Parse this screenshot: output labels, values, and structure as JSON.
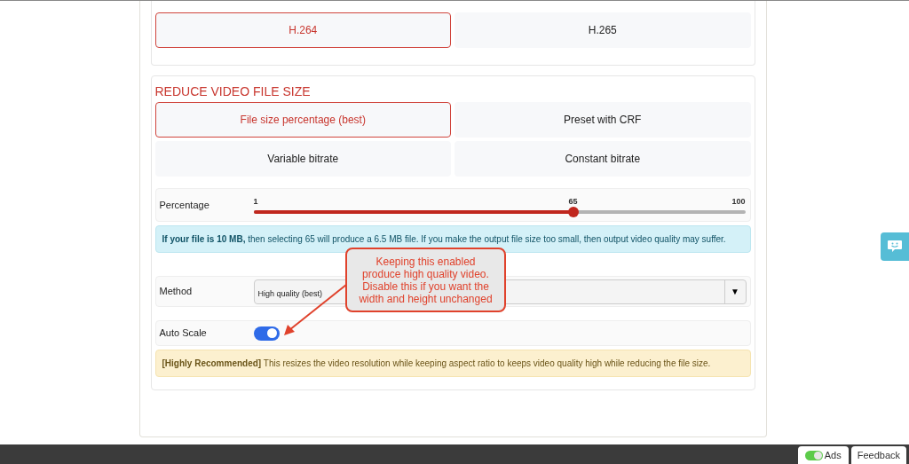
{
  "codec_options": [
    {
      "label": "H.264",
      "selected": true
    },
    {
      "label": "H.265",
      "selected": false
    }
  ],
  "reduce": {
    "heading": "REDUCE VIDEO FILE SIZE",
    "options": [
      {
        "label": "File size percentage (best)",
        "selected": true
      },
      {
        "label": "Preset with CRF",
        "selected": false
      },
      {
        "label": "Variable bitrate",
        "selected": false
      },
      {
        "label": "Constant bitrate",
        "selected": false
      }
    ],
    "percentage": {
      "label": "Percentage",
      "min": "1",
      "value": "65",
      "max": "100",
      "level": 0.65
    },
    "info": "**If your file is 10 MB,** then selecting 65 will produce a 6.5 MB file. If you make the output file size too small, then output video quality may suffer.",
    "method": {
      "label": "Method",
      "value": "High quality (best)",
      "caret": "▼"
    },
    "auto_scale": {
      "label": "Auto Scale",
      "on": true
    },
    "warning": "**[Highly Recommended]** This resizes the video resolution while keeping aspect ratio to keeps video quality high while reducing the file size."
  },
  "callout": "Keeping this enabled produce high quality video. Disable this if you want the width and height unchanged",
  "bottom_bar": {
    "ads": {
      "label": "Ads",
      "on": true
    },
    "feedback": "Feedback"
  }
}
